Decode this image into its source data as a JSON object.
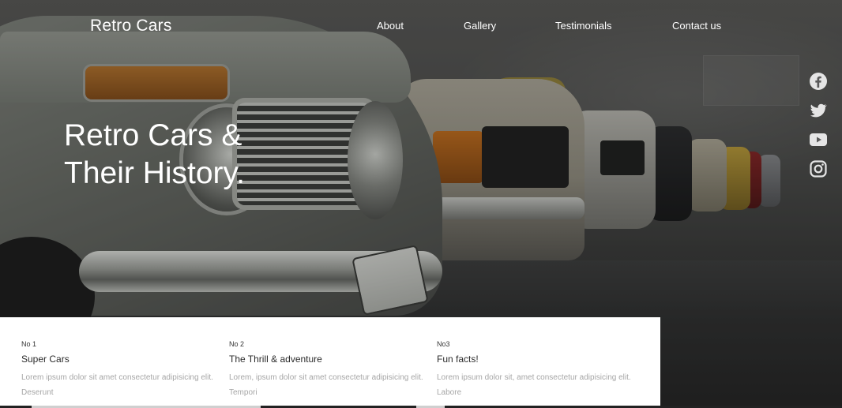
{
  "header": {
    "brand": "Retro Cars",
    "nav": [
      "About",
      "Gallery",
      "Testimonials",
      "Contact us"
    ]
  },
  "hero": {
    "title_line1": "Retro Cars &",
    "title_line2": "Their History."
  },
  "social": {
    "icons": [
      "facebook-icon",
      "twitter-icon",
      "youtube-icon",
      "instagram-icon"
    ],
    "color": "#e5e5e5"
  },
  "features": [
    {
      "number": "No 1",
      "title": "Super Cars",
      "text": "Lorem ipsum dolor sit amet consectetur adipisicing elit. Deserunt"
    },
    {
      "number": "No 2",
      "title": "The Thrill & adventure",
      "text": "Lorem, ipsum dolor sit amet consectetur adipisicing elit. Tempori"
    },
    {
      "number": "No3",
      "title": "Fun facts!",
      "text": "Lorem ipsum dolor sit, amet consectetur adipisicing elit. Labore"
    }
  ],
  "colors": {
    "text_light": "#ffffff",
    "card_bg": "#ffffff",
    "muted_text": "#a6a6a6"
  }
}
